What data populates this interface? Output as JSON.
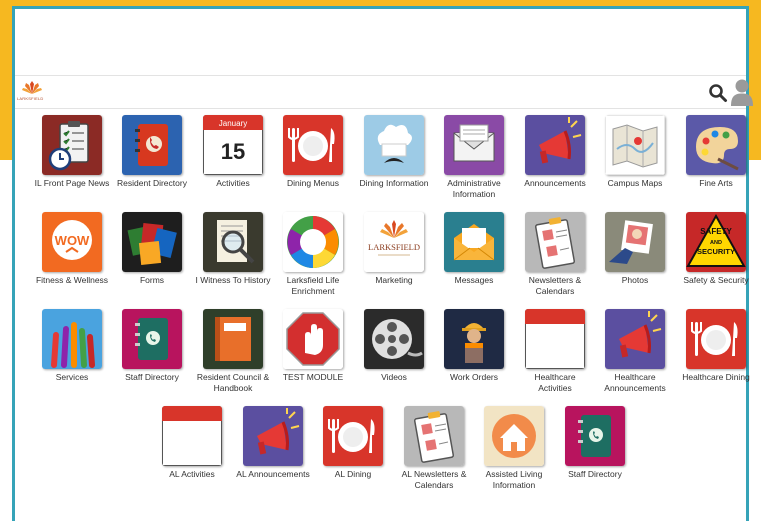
{
  "header": {
    "logo_text": "LARKSFIELD",
    "search_icon": "search-icon",
    "user_icon": "user-icon"
  },
  "colors": {
    "frame_border": "#35a3b8",
    "yellow_band": "#f6b820"
  },
  "rows": [
    [
      {
        "label": "IL Front Page News",
        "icon": "clipboard-clock-icon"
      },
      {
        "label": "Resident Directory",
        "icon": "address-book-icon"
      },
      {
        "label": "Activities",
        "icon": "calendar-icon",
        "month": "January",
        "day": "15"
      },
      {
        "label": "Dining Menus",
        "icon": "plate-utensils-icon"
      },
      {
        "label": "Dining Information",
        "icon": "chef-icon"
      },
      {
        "label": "Administrative Information",
        "icon": "envelope-icon"
      },
      {
        "label": "Announcements",
        "icon": "megaphone-icon"
      },
      {
        "label": "Campus Maps",
        "icon": "map-icon"
      },
      {
        "label": "Fine Arts",
        "icon": "palette-icon"
      }
    ],
    [
      {
        "label": "Fitness & Wellness",
        "icon": "wow-icon",
        "badge": "WOW"
      },
      {
        "label": "Forms",
        "icon": "forms-icon"
      },
      {
        "label": "I Witness To History",
        "icon": "magnifier-document-icon"
      },
      {
        "label": "Larksfield Life Enrichment",
        "icon": "life-enrichment-wheel-icon"
      },
      {
        "label": "Marketing",
        "icon": "larksfield-logo-icon",
        "logo_word": "LARKSFIELD"
      },
      {
        "label": "Messages",
        "icon": "open-envelope-icon"
      },
      {
        "label": "Newsletters & Calendars",
        "icon": "newsletter-clipboard-icon"
      },
      {
        "label": "Photos",
        "icon": "photo-hand-icon"
      },
      {
        "label": "Safety & Security",
        "icon": "safety-sign-icon",
        "sign_top": "SAFETY",
        "sign_mid": "AND",
        "sign_bot": "SECURITY"
      }
    ],
    [
      {
        "label": "Services",
        "icon": "raised-hands-icon"
      },
      {
        "label": "Staff Directory",
        "icon": "phone-book-icon"
      },
      {
        "label": "Resident Council & Handbook",
        "icon": "handbook-icon"
      },
      {
        "label": "TEST MODULE",
        "icon": "stop-hand-icon"
      },
      {
        "label": "Videos",
        "icon": "film-reel-icon"
      },
      {
        "label": "Work Orders",
        "icon": "worker-icon"
      },
      {
        "label": "Healthcare Activities",
        "icon": "blank-calendar-icon"
      },
      {
        "label": "Healthcare Announcements",
        "icon": "megaphone-icon"
      },
      {
        "label": "Healthcare Dining",
        "icon": "plate-utensils-icon"
      }
    ],
    [
      {
        "label": "AL Activities",
        "icon": "blank-calendar-icon"
      },
      {
        "label": "AL Announcements",
        "icon": "megaphone-icon"
      },
      {
        "label": "AL Dining",
        "icon": "plate-utensils-icon"
      },
      {
        "label": "AL Newsletters & Calendars",
        "icon": "newsletter-clipboard-icon"
      },
      {
        "label": "Assisted Living Information",
        "icon": "house-icon"
      },
      {
        "label": "Staff Directory",
        "icon": "phone-book-icon"
      }
    ]
  ]
}
